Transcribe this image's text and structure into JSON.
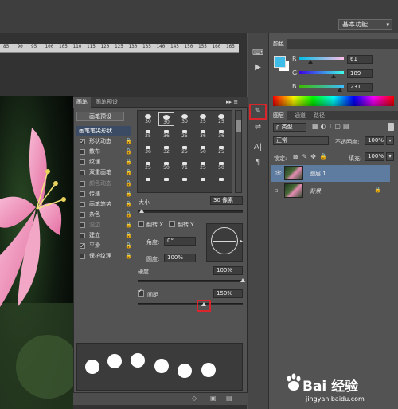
{
  "toolbar": {
    "workspace": "基本功能"
  },
  "ruler": {
    "ticks": [
      "85",
      "90",
      "95",
      "100",
      "105",
      "110",
      "115",
      "120",
      "125",
      "130",
      "135",
      "140",
      "145",
      "150",
      "155",
      "160",
      "165"
    ]
  },
  "brush_panel": {
    "tabs": [
      "画笔",
      "画笔预设"
    ],
    "menu_glyph": "▸▸ ≡",
    "preset_button": "画笔预设",
    "options": [
      {
        "label": "画笔笔尖形状",
        "checked": null,
        "selected": true,
        "dim": false,
        "lock": false
      },
      {
        "label": "形状动态",
        "checked": true,
        "selected": false,
        "dim": false,
        "lock": true
      },
      {
        "label": "散布",
        "checked": false,
        "selected": false,
        "dim": false,
        "lock": true
      },
      {
        "label": "纹理",
        "checked": false,
        "selected": false,
        "dim": false,
        "lock": true
      },
      {
        "label": "双重画笔",
        "checked": false,
        "selected": false,
        "dim": false,
        "lock": true
      },
      {
        "label": "颜色动态",
        "checked": false,
        "selected": false,
        "dim": true,
        "lock": true
      },
      {
        "label": "传递",
        "checked": false,
        "selected": false,
        "dim": false,
        "lock": true
      },
      {
        "label": "画笔笔势",
        "checked": false,
        "selected": false,
        "dim": false,
        "lock": true
      },
      {
        "label": "杂色",
        "checked": false,
        "selected": false,
        "dim": false,
        "lock": true
      },
      {
        "label": "湿边",
        "checked": false,
        "selected": false,
        "dim": true,
        "lock": true
      },
      {
        "label": "建立",
        "checked": false,
        "selected": false,
        "dim": false,
        "lock": true
      },
      {
        "label": "平滑",
        "checked": true,
        "selected": false,
        "dim": false,
        "lock": true
      },
      {
        "label": "保护纹理",
        "checked": false,
        "selected": false,
        "dim": false,
        "lock": true
      }
    ],
    "tips": [
      "30",
      "30",
      "30",
      "25",
      "25",
      "25",
      "36",
      "25",
      "36",
      "36",
      "36",
      "32",
      "25",
      "50",
      "25",
      "25",
      "50",
      "71",
      "25",
      "50",
      "",
      "",
      "",
      "",
      ""
    ],
    "size_label": "大小",
    "size_value": "30 像素",
    "flip_x": "翻转 X",
    "flip_y": "翻转 Y",
    "angle_label": "角度:",
    "angle_value": "0°",
    "roundness_label": "圆度:",
    "roundness_value": "100%",
    "hardness_label": "硬度",
    "hardness_value": "100%",
    "spacing_label": "间距",
    "spacing_value": "150%",
    "spacing_checked": true,
    "bottom_icons": [
      "◇",
      "▣",
      "▤"
    ]
  },
  "side_icons": [
    "⌨",
    "▶",
    "✎",
    "⇌",
    "A|",
    "¶"
  ],
  "color_panel": {
    "tab": "颜色",
    "fg_color": "#3dbde7",
    "r_label": "R",
    "r_value": "61",
    "g_label": "G",
    "g_value": "189",
    "b_label": "B",
    "b_value": "231"
  },
  "layers_panel": {
    "tabs": [
      "图层",
      "通道",
      "路径"
    ],
    "kind_filter": "ρ 类型",
    "blend_mode": "正常",
    "opacity_label": "不透明度:",
    "opacity_value": "100%",
    "lock_label": "锁定:",
    "fill_label": "填充:",
    "fill_value": "100%",
    "layers": [
      {
        "name": "图层 1",
        "selected": true,
        "italic": false,
        "visible": true
      },
      {
        "name": "背景",
        "selected": false,
        "italic": true,
        "visible": false
      }
    ]
  },
  "watermark": {
    "brand": "Bai 经验",
    "url": "jingyan.baidu.com"
  }
}
